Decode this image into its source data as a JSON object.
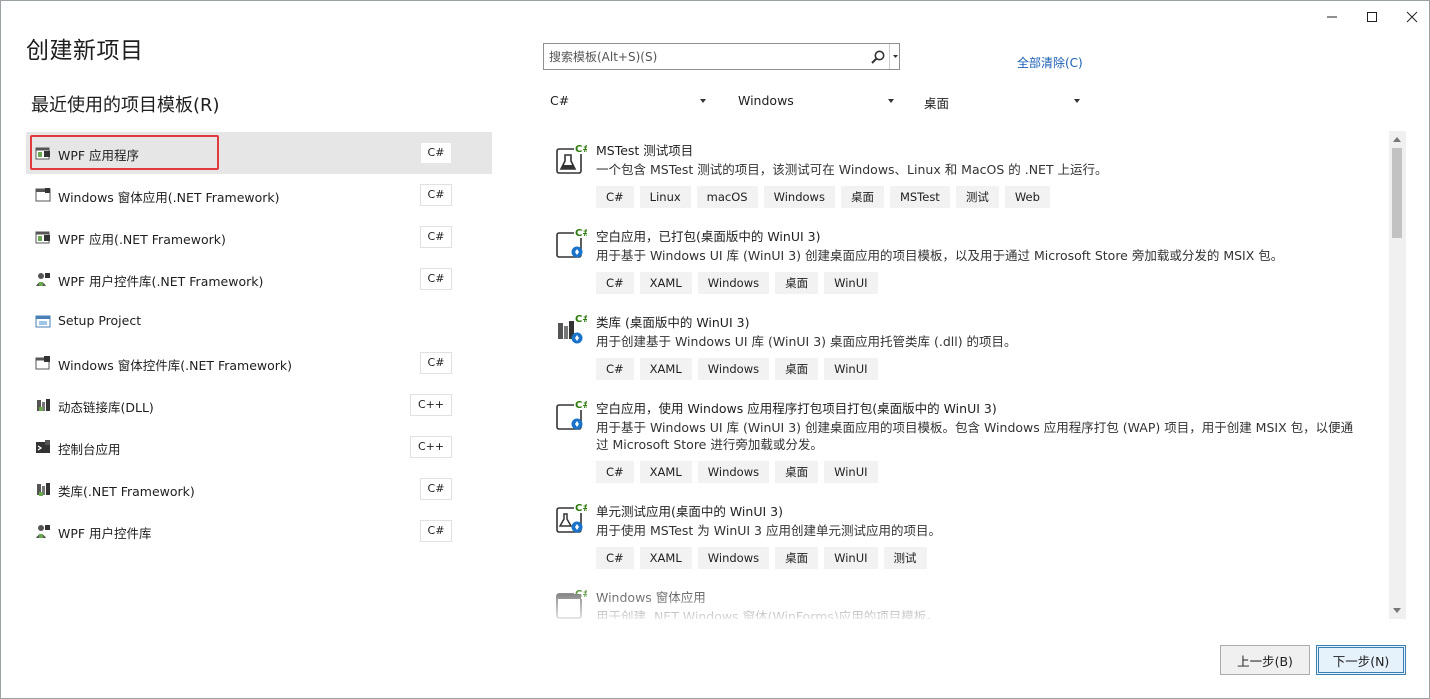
{
  "window": {
    "controls": {
      "minimize": "minimize-icon",
      "maximize": "maximize-icon",
      "close": "close-icon"
    }
  },
  "page": {
    "title": "创建新项目",
    "recent_title": "最近使用的项目模板(R)"
  },
  "recent": [
    {
      "label": "WPF 应用程序",
      "lang": "C#",
      "icon": "wpf-app-icon",
      "selected": true
    },
    {
      "label": "Windows 窗体应用(.NET Framework)",
      "lang": "C#",
      "icon": "winforms-app-icon"
    },
    {
      "label": "WPF 应用(.NET Framework)",
      "lang": "C#",
      "icon": "wpf-app-icon"
    },
    {
      "label": "WPF 用户控件库(.NET Framework)",
      "lang": "C#",
      "icon": "user-control-icon"
    },
    {
      "label": "Setup Project",
      "lang": "",
      "icon": "setup-project-icon"
    },
    {
      "label": "Windows 窗体控件库(.NET Framework)",
      "lang": "C#",
      "icon": "winforms-control-icon"
    },
    {
      "label": "动态链接库(DLL)",
      "lang": "C++",
      "icon": "dll-icon"
    },
    {
      "label": "控制台应用",
      "lang": "C++",
      "icon": "console-app-icon"
    },
    {
      "label": "类库(.NET Framework)",
      "lang": "C#",
      "icon": "class-library-icon"
    },
    {
      "label": "WPF 用户控件库",
      "lang": "C#",
      "icon": "user-control-icon"
    }
  ],
  "search": {
    "placeholder": "搜索模板(Alt+S)(S)",
    "value": ""
  },
  "clear_all": "全部清除(C)",
  "filters": {
    "language": "C#",
    "platform": "Windows",
    "project_type": "桌面"
  },
  "templates": [
    {
      "name": "MSTest 测试项目",
      "desc": "一个包含 MSTest 测试的项目，该测试可在 Windows、Linux 和 MacOS 的 .NET 上运行。",
      "tags": [
        "C#",
        "Linux",
        "macOS",
        "Windows",
        "桌面",
        "MSTest",
        "测试",
        "Web"
      ],
      "icon": "mstest-project-icon"
    },
    {
      "name": "空白应用，已打包(桌面版中的 WinUI 3)",
      "desc": "用于基于 Windows UI 库 (WinUI 3) 创建桌面应用的项目模板，以及用于通过 Microsoft Store 旁加载或分发的 MSIX 包。",
      "tags": [
        "C#",
        "XAML",
        "Windows",
        "桌面",
        "WinUI"
      ],
      "icon": "blank-app-packaged-icon"
    },
    {
      "name": "类库 (桌面版中的 WinUI 3)",
      "desc": "用于创建基于 Windows UI 库 (WinUI 3) 桌面应用托管类库 (.dll) 的项目。",
      "tags": [
        "C#",
        "XAML",
        "Windows",
        "桌面",
        "WinUI"
      ],
      "icon": "class-library-winui-icon"
    },
    {
      "name": "空白应用，使用 Windows 应用程序打包项目打包(桌面版中的 WinUI 3)",
      "desc": "用于基于 Windows UI 库 (WinUI 3) 创建桌面应用的项目模板。包含 Windows 应用程序打包 (WAP) 项目，用于创建 MSIX 包，以便通过 Microsoft Store 进行旁加载或分发。",
      "tags": [
        "C#",
        "XAML",
        "Windows",
        "桌面",
        "WinUI"
      ],
      "icon": "blank-app-wap-icon"
    },
    {
      "name": "单元测试应用(桌面中的 WinUI 3)",
      "desc": "用于使用 MSTest 为 WinUI 3 应用创建单元测试应用的项目。",
      "tags": [
        "C#",
        "XAML",
        "Windows",
        "桌面",
        "WinUI",
        "测试"
      ],
      "icon": "unit-test-app-icon"
    },
    {
      "name": "Windows 窗体应用",
      "desc": "用于创建 .NET Windows 窗体(WinForms)应用的项目模板。",
      "tags": [],
      "icon": "winforms-app-icon"
    }
  ],
  "buttons": {
    "back": "上一步(B)",
    "next": "下一步(N)"
  }
}
